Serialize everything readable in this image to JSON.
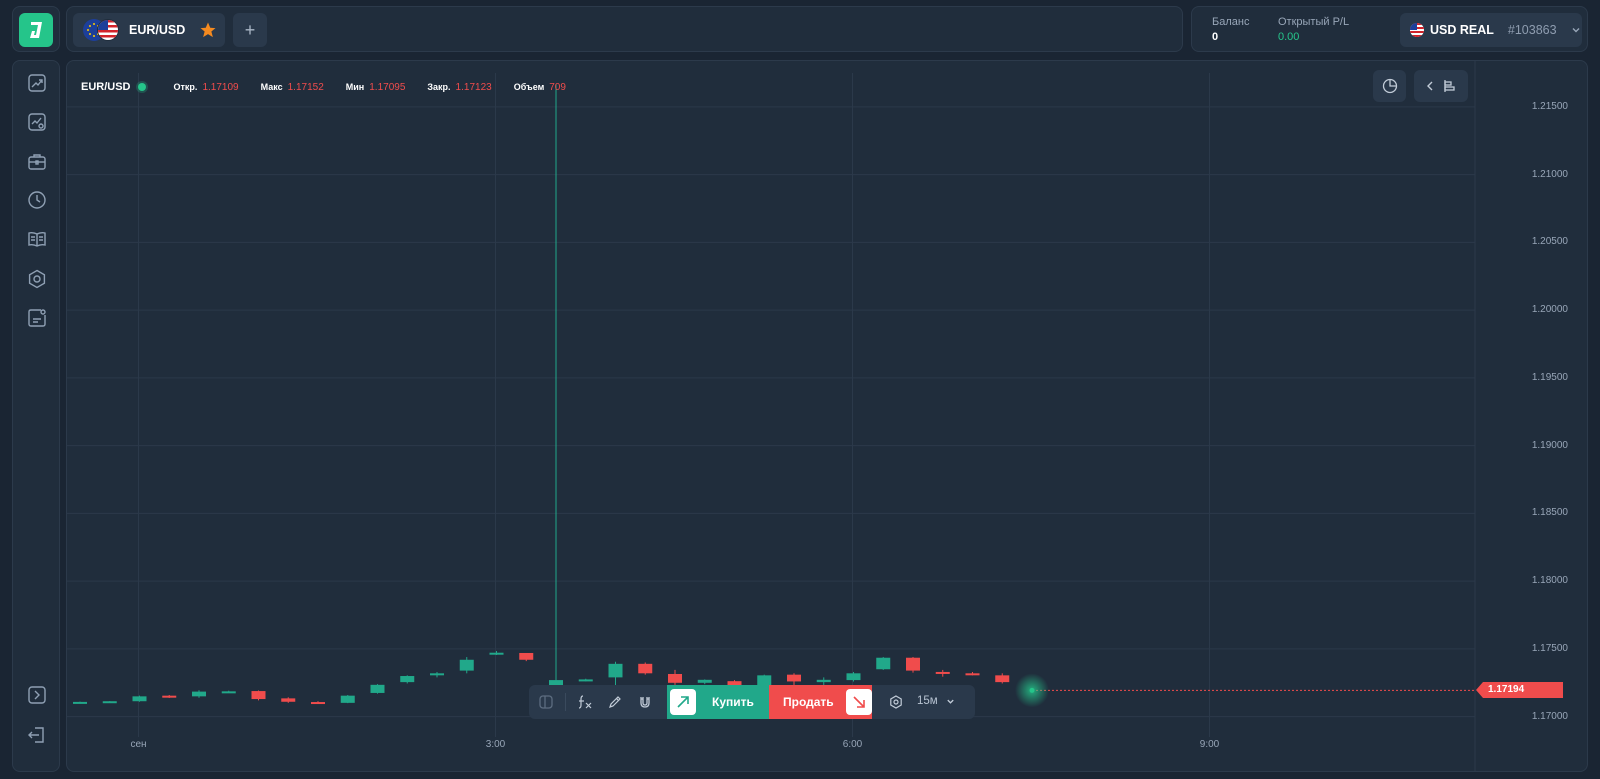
{
  "header": {
    "tab": {
      "symbol": "EUR/USD",
      "favorite": true,
      "favorite_color": "#f58a1f"
    },
    "add_tab_label": "+",
    "account": {
      "balance_label": "Баланс",
      "balance_value": "0",
      "pnl_label": "Открытый P/L",
      "pnl_value": "0.00",
      "currency_label": "USD REAL",
      "account_number": "#103863"
    }
  },
  "sidebar": {
    "items": [
      {
        "icon": "trading-chart-icon"
      },
      {
        "icon": "analytics-icon"
      },
      {
        "icon": "portfolio-icon"
      },
      {
        "icon": "history-clock-icon"
      },
      {
        "icon": "education-book-icon"
      },
      {
        "icon": "settings-gear-icon"
      },
      {
        "icon": "support-chat-icon"
      },
      {
        "icon": "expand-panel-icon"
      },
      {
        "icon": "logout-icon"
      }
    ]
  },
  "chart": {
    "symbol": "EUR/USD",
    "ohlc": [
      {
        "key": "Откр.",
        "value": "1.17109"
      },
      {
        "key": "Макс",
        "value": "1.17152"
      },
      {
        "key": "Мин",
        "value": "1.17095"
      },
      {
        "key": "Закр.",
        "value": "1.17123"
      },
      {
        "key": "Объем",
        "value": "709"
      }
    ],
    "current_price": "1.17194"
  },
  "trade_bar": {
    "buy_label": "Купить",
    "sell_label": "Продать",
    "timeframe": "15м"
  },
  "colors": {
    "up": "#21a88a",
    "down": "#f04c4c",
    "accent": "#25c58a",
    "background": "#202d3c"
  },
  "chart_data": {
    "type": "candlestick",
    "y_ticks": [
      "1.21500",
      "1.21000",
      "1.20500",
      "1.20000",
      "1.19500",
      "1.19000",
      "1.18500",
      "1.18000",
      "1.17500",
      "1.17000"
    ],
    "x_ticks": [
      "сен",
      "3:00",
      "6:00",
      "9:00"
    ],
    "ylim": [
      1.1685,
      1.2175
    ],
    "grid": true,
    "last_price": 1.17194,
    "candles": [
      {
        "o": 1.17108,
        "h": 1.17111,
        "l": 1.17104,
        "c": 1.17109
      },
      {
        "o": 1.1711,
        "h": 1.17115,
        "l": 1.17107,
        "c": 1.17114
      },
      {
        "o": 1.17114,
        "h": 1.17155,
        "l": 1.1711,
        "c": 1.1715
      },
      {
        "o": 1.17155,
        "h": 1.1716,
        "l": 1.17138,
        "c": 1.17148
      },
      {
        "o": 1.1715,
        "h": 1.17195,
        "l": 1.1714,
        "c": 1.17185
      },
      {
        "o": 1.1718,
        "h": 1.17192,
        "l": 1.17175,
        "c": 1.17187
      },
      {
        "o": 1.17189,
        "h": 1.17193,
        "l": 1.1712,
        "c": 1.1713
      },
      {
        "o": 1.17135,
        "h": 1.17143,
        "l": 1.17102,
        "c": 1.1711
      },
      {
        "o": 1.17108,
        "h": 1.17115,
        "l": 1.171,
        "c": 1.17106
      },
      {
        "o": 1.17102,
        "h": 1.1716,
        "l": 1.171,
        "c": 1.17155
      },
      {
        "o": 1.17175,
        "h": 1.1724,
        "l": 1.1717,
        "c": 1.17235
      },
      {
        "o": 1.17255,
        "h": 1.17305,
        "l": 1.17245,
        "c": 1.173
      },
      {
        "o": 1.17315,
        "h": 1.1733,
        "l": 1.1729,
        "c": 1.1732
      },
      {
        "o": 1.1734,
        "h": 1.1744,
        "l": 1.1732,
        "c": 1.1742
      },
      {
        "o": 1.1747,
        "h": 1.17485,
        "l": 1.17455,
        "c": 1.17472
      },
      {
        "o": 1.1747,
        "h": 1.17465,
        "l": 1.1741,
        "c": 1.1742
      },
      {
        "o": 1.1723,
        "h": 1.2167,
        "l": 1.1722,
        "c": 1.1727
      },
      {
        "o": 1.1727,
        "h": 1.1728,
        "l": 1.1726,
        "c": 1.17275
      },
      {
        "o": 1.1729,
        "h": 1.17405,
        "l": 1.1723,
        "c": 1.1739
      },
      {
        "o": 1.1739,
        "h": 1.174,
        "l": 1.1731,
        "c": 1.1732
      },
      {
        "o": 1.17315,
        "h": 1.17345,
        "l": 1.17235,
        "c": 1.1725
      },
      {
        "o": 1.1725,
        "h": 1.17275,
        "l": 1.1724,
        "c": 1.17272
      },
      {
        "o": 1.17262,
        "h": 1.1727,
        "l": 1.17195,
        "c": 1.17215
      },
      {
        "o": 1.1722,
        "h": 1.1731,
        "l": 1.17215,
        "c": 1.17305
      },
      {
        "o": 1.1731,
        "h": 1.1732,
        "l": 1.17225,
        "c": 1.1726
      },
      {
        "o": 1.17255,
        "h": 1.1729,
        "l": 1.1721,
        "c": 1.17272
      },
      {
        "o": 1.1727,
        "h": 1.1733,
        "l": 1.1726,
        "c": 1.1732
      },
      {
        "o": 1.1735,
        "h": 1.1744,
        "l": 1.17345,
        "c": 1.17435
      },
      {
        "o": 1.17435,
        "h": 1.1744,
        "l": 1.17325,
        "c": 1.1734
      },
      {
        "o": 1.1733,
        "h": 1.17345,
        "l": 1.17295,
        "c": 1.1732
      },
      {
        "o": 1.1732,
        "h": 1.1733,
        "l": 1.17305,
        "c": 1.17315
      },
      {
        "o": 1.17305,
        "h": 1.1732,
        "l": 1.17245,
        "c": 1.17255
      }
    ]
  }
}
